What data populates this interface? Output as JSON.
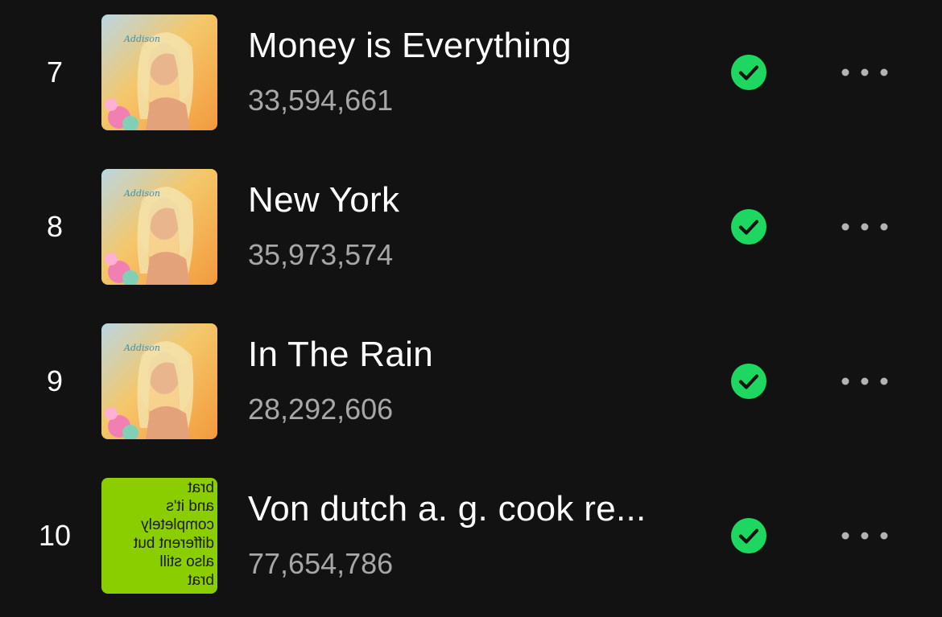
{
  "colors": {
    "background": "#121212",
    "title": "#ffffff",
    "plays": "#a7a7a7",
    "check_green": "#1ed760",
    "more_dots": "#b3b3b3",
    "brat_green": "#8ace00"
  },
  "tracks": [
    {
      "number": "7",
      "title": "Money is Everything",
      "plays": "33,594,661",
      "cover": "album-art-portrait",
      "cover_text": "Addison",
      "icons": {
        "saved": "check-circle-icon",
        "more": "more-options-icon"
      }
    },
    {
      "number": "8",
      "title": "New York",
      "plays": "35,973,574",
      "cover": "album-art-portrait",
      "cover_text": "Addison",
      "icons": {
        "saved": "check-circle-icon",
        "more": "more-options-icon"
      }
    },
    {
      "number": "9",
      "title": "In The Rain",
      "plays": "28,292,606",
      "cover": "album-art-portrait",
      "cover_text": "Addison",
      "icons": {
        "saved": "check-circle-icon",
        "more": "more-options-icon"
      }
    },
    {
      "number": "10",
      "title": "Von dutch a. g. cook re...",
      "plays": "77,654,786",
      "cover": "album-art-brat",
      "cover_lines": [
        "brat",
        "and it's",
        "completely",
        "different but",
        "also still",
        "brat"
      ],
      "icons": {
        "saved": "check-circle-icon",
        "more": "more-options-icon"
      }
    }
  ]
}
